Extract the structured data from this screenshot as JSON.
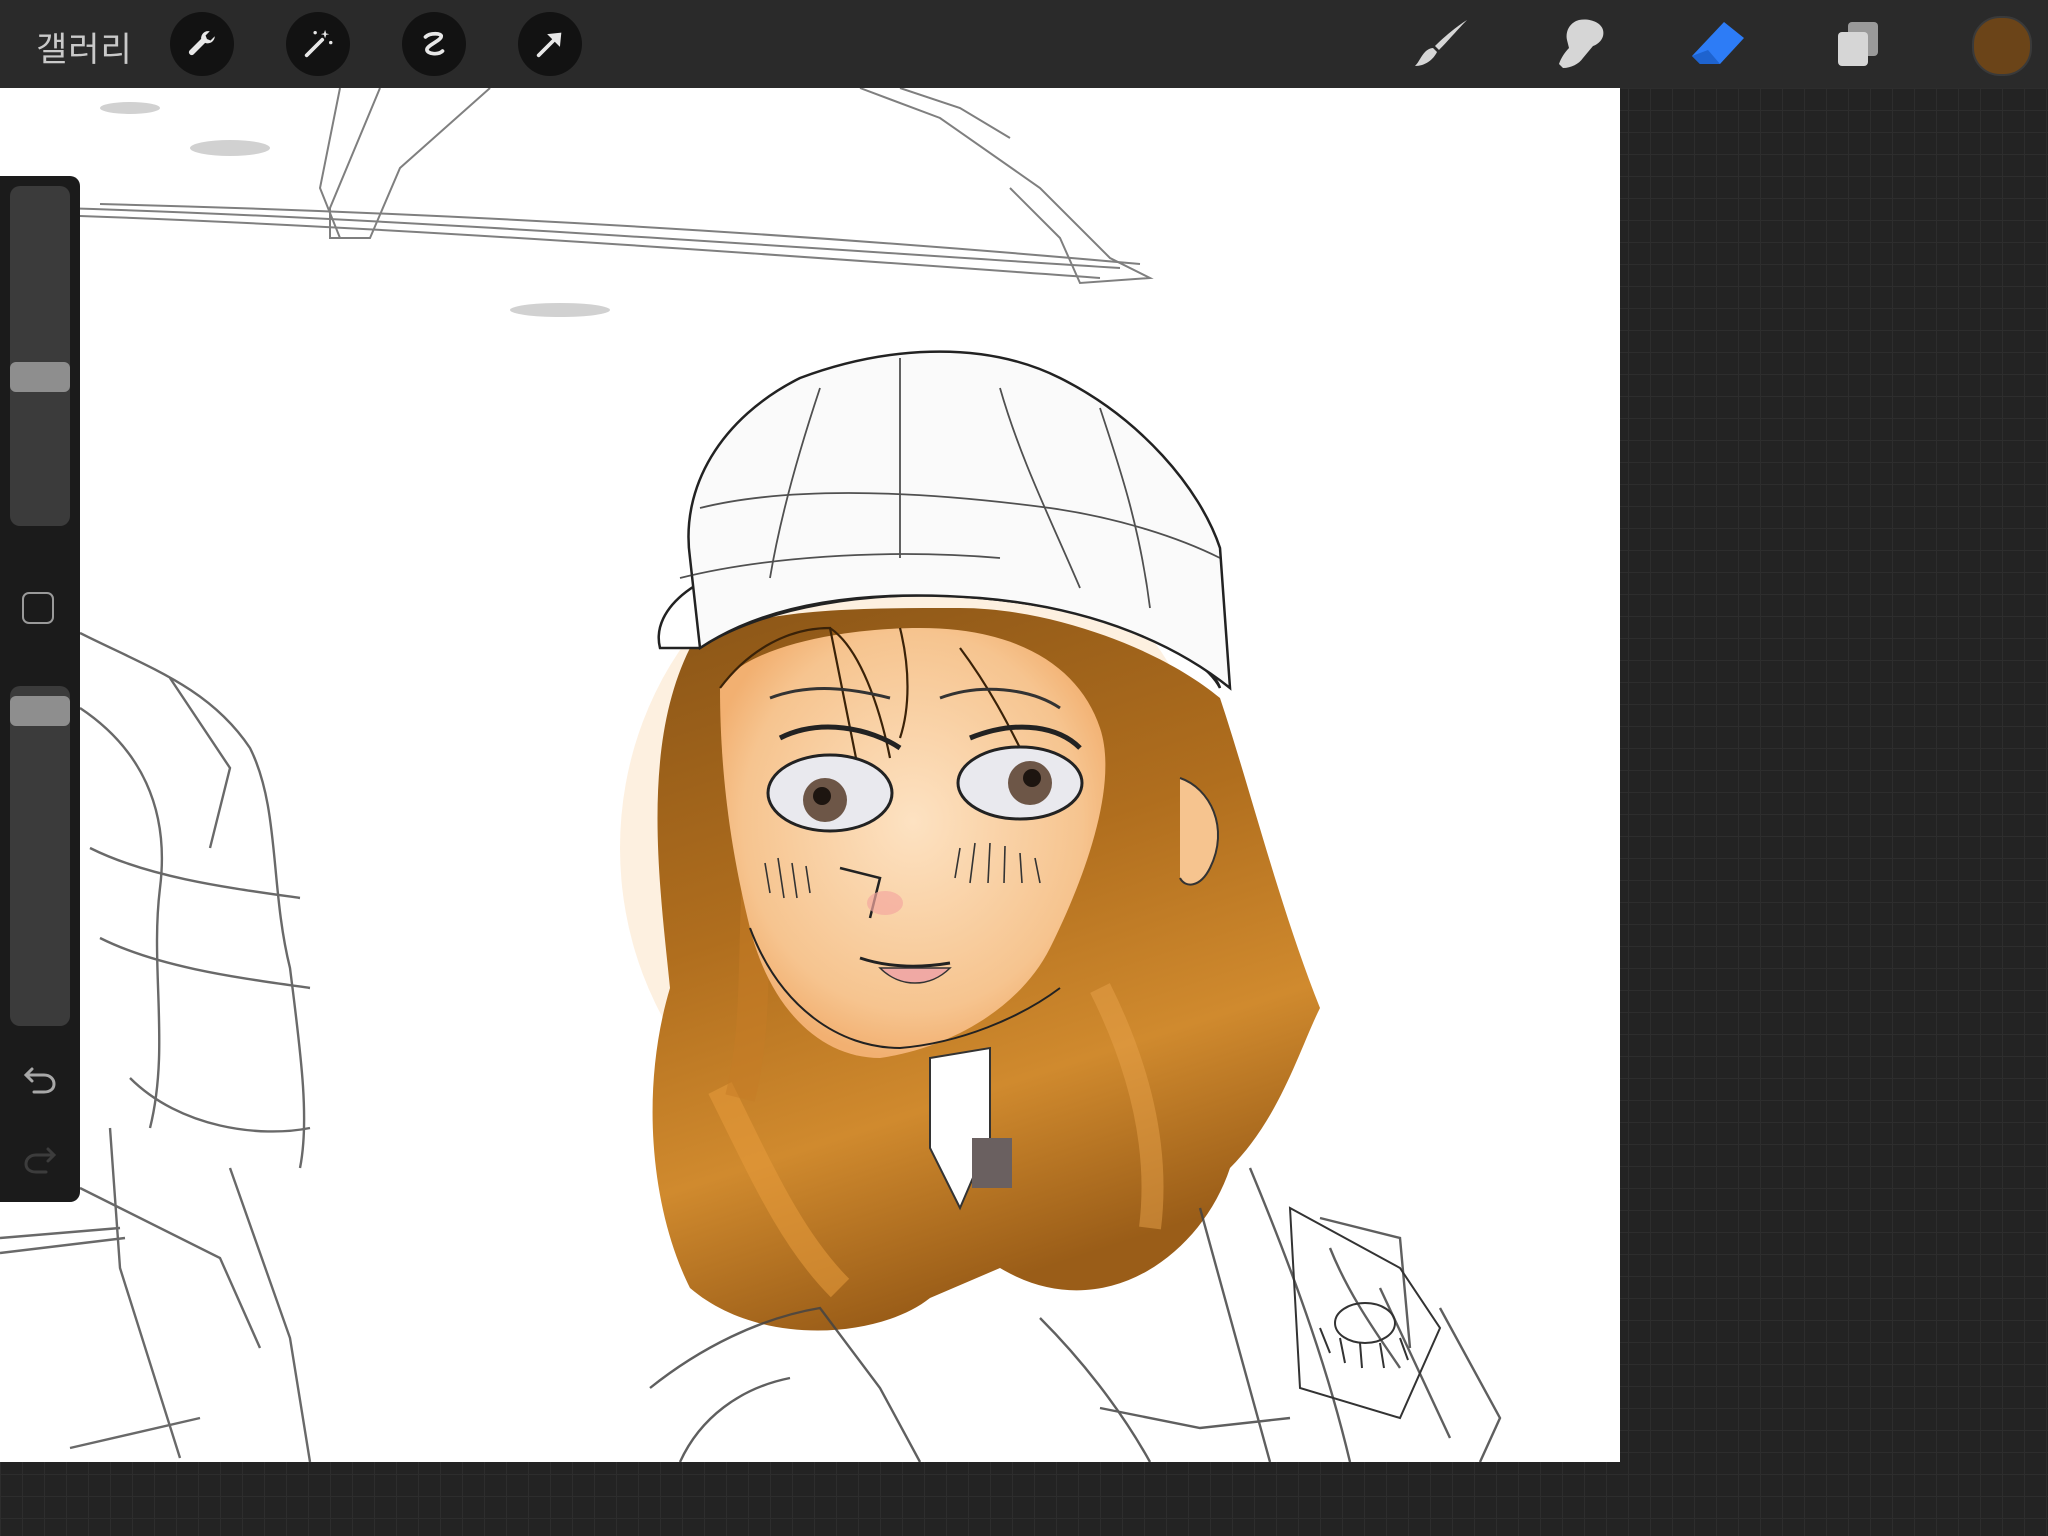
{
  "topbar": {
    "gallery_label": "갤러리",
    "left_tools": [
      "wrench-icon",
      "magic-wand-icon",
      "selection-icon",
      "transform-arrow-icon"
    ],
    "right_tools": [
      "brush-icon",
      "smudge-icon",
      "eraser-icon",
      "layers-icon"
    ],
    "active_tool": "eraser",
    "active_color": "#6b4418",
    "accent_color": "#2d7cf6"
  },
  "sidebar": {
    "brush_size_level": 0.55,
    "opacity_level": 0.96
  },
  "canvas": {
    "artwork": "sketch-of-girl-with-cap-and-brown-hair"
  }
}
